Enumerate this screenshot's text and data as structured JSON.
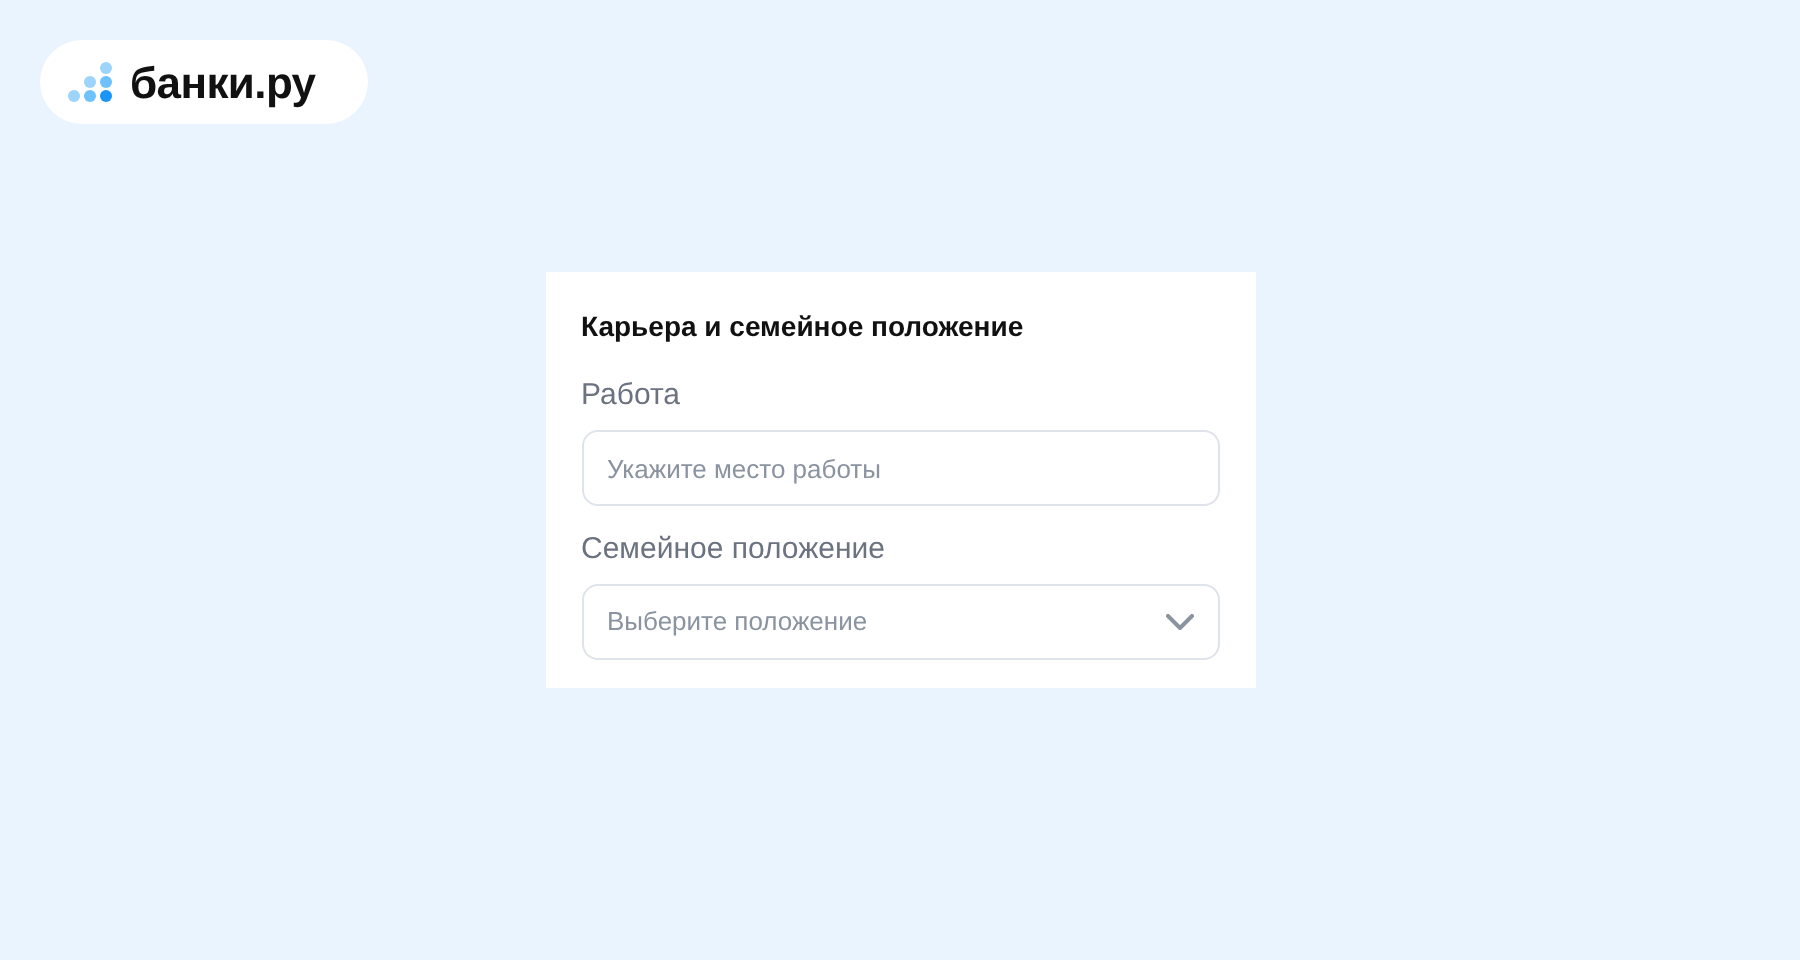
{
  "logo": {
    "text": "банки.ру"
  },
  "form": {
    "title": "Карьера и семейное положение",
    "fields": [
      {
        "kind": "text",
        "label": "Работа",
        "placeholder": "Укажите место работы"
      },
      {
        "kind": "select",
        "label": "Семейное положение",
        "placeholder": "Выберите положение"
      }
    ]
  }
}
